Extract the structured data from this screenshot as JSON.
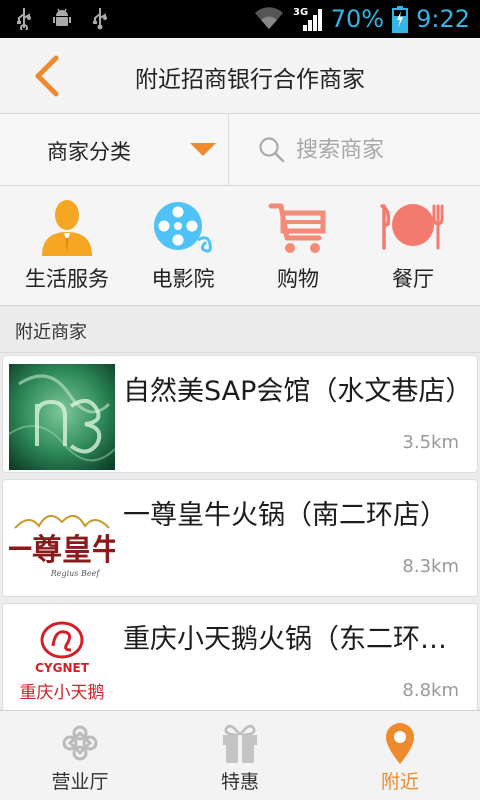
{
  "status_bar": {
    "battery": "70%",
    "time": "9:22",
    "network": "3G"
  },
  "header": {
    "title": "附近招商银行合作商家"
  },
  "filter": {
    "category_label": "商家分类",
    "search_placeholder": "搜索商家"
  },
  "categories": [
    {
      "label": "生活服务",
      "icon": "person-icon"
    },
    {
      "label": "电影院",
      "icon": "film-reel-icon"
    },
    {
      "label": "购物",
      "icon": "shopping-cart-icon"
    },
    {
      "label": "餐厅",
      "icon": "plate-fork-knife-icon"
    }
  ],
  "section": {
    "title": "附近商家"
  },
  "merchants": [
    {
      "name": "自然美SAP会馆（水文巷店）",
      "distance": "3.5km"
    },
    {
      "name": "一尊皇牛火锅（南二环店）",
      "distance": "8.3km"
    },
    {
      "name": "重庆小天鹅火锅（东二环店）",
      "distance": "8.8km"
    }
  ],
  "logos": {
    "merchant_2": {
      "text_main": "一尊皇牛",
      "text_sub": "Regius Beef"
    },
    "merchant_3": {
      "brand": "CYGNET",
      "text_main": "重庆小天鹅"
    }
  },
  "tabs": [
    {
      "label": "营业厅",
      "icon": "unicom-knot-icon",
      "active": false
    },
    {
      "label": "特惠",
      "icon": "gift-box-icon",
      "active": false
    },
    {
      "label": "附近",
      "icon": "location-pin-icon",
      "active": true
    }
  ],
  "colors": {
    "accent": "#f08a2e",
    "icon_orange": "#f5a623",
    "icon_blue": "#4fc3f7",
    "icon_salmon": "#f48b78",
    "status_text": "#33b5e5"
  }
}
